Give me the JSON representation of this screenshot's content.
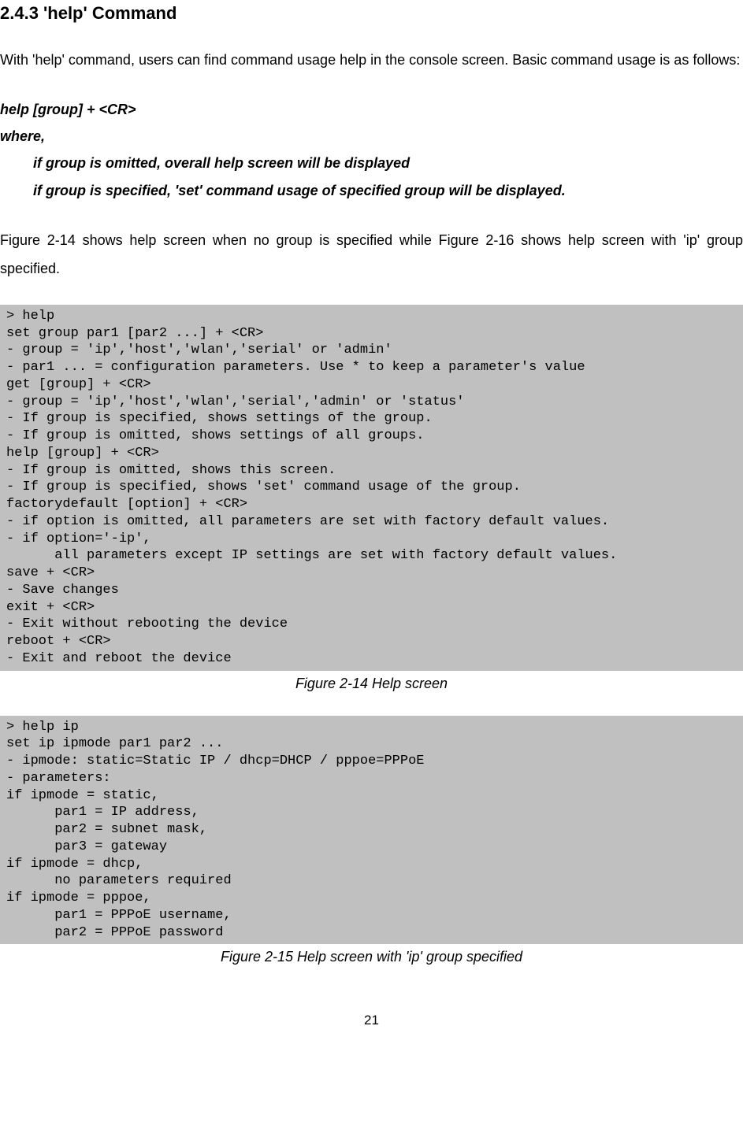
{
  "section": {
    "title": "2.4.3 'help' Command"
  },
  "intro": "With 'help' command, users can find command usage help in the console screen. Basic command usage is as follows:",
  "syntax": {
    "line1": "help [group] + <CR>",
    "line2": "where,",
    "line3": "if group is omitted, overall help screen will be displayed",
    "line4": "if group is specified, 'set' command usage of specified group will be displayed."
  },
  "bridge": "Figure 2-14 shows help screen when no group is specified while Figure 2-16 shows help screen with 'ip' group specified.",
  "console1": "> help\nset group par1 [par2 ...] + <CR>\n- group = 'ip','host','wlan','serial' or 'admin'\n- par1 ... = configuration parameters. Use * to keep a parameter's value\nget [group] + <CR>\n- group = 'ip','host','wlan','serial','admin' or 'status'\n- If group is specified, shows settings of the group.\n- If group is omitted, shows settings of all groups.\nhelp [group] + <CR>\n- If group is omitted, shows this screen.\n- If group is specified, shows 'set' command usage of the group.\nfactorydefault [option] + <CR>\n- if option is omitted, all parameters are set with factory default values.\n- if option='-ip',\n      all parameters except IP settings are set with factory default values.\nsave + <CR>\n- Save changes\nexit + <CR>\n- Exit without rebooting the device\nreboot + <CR>\n- Exit and reboot the device",
  "caption1": "Figure 2-14 Help screen",
  "console2": "> help ip\nset ip ipmode par1 par2 ...\n- ipmode: static=Static IP / dhcp=DHCP / pppoe=PPPoE\n- parameters:\nif ipmode = static,\n      par1 = IP address,\n      par2 = subnet mask,\n      par3 = gateway\nif ipmode = dhcp,\n      no parameters required\nif ipmode = pppoe,\n      par1 = PPPoE username,\n      par2 = PPPoE password\n",
  "caption2": "Figure 2-15 Help screen with 'ip' group specified",
  "pageNumber": "21"
}
